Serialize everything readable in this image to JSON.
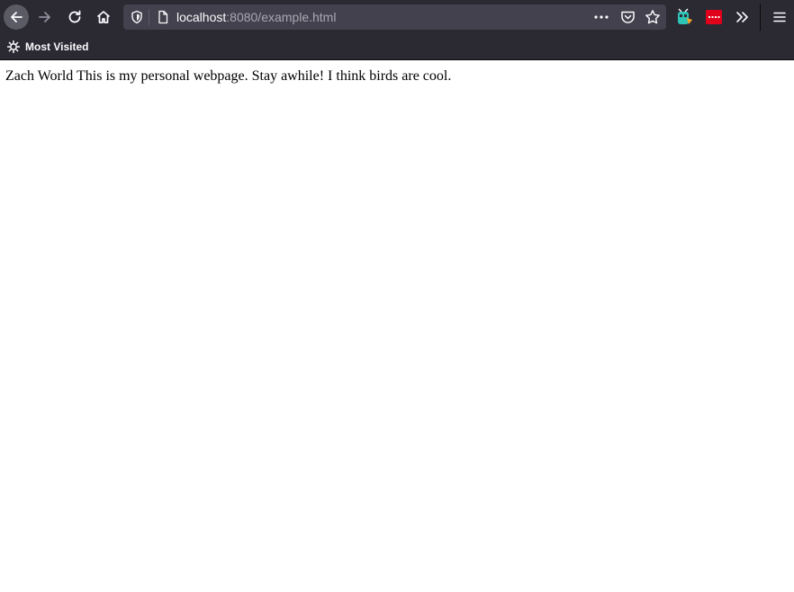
{
  "browser": {
    "url_host": "localhost",
    "url_rest": ":8080/example.html",
    "bookmarks": [
      {
        "label": "Most Visited",
        "icon": "gear-icon"
      }
    ],
    "icons": {
      "back": "arrow-left-icon",
      "forward": "arrow-right-icon",
      "reload": "reload-icon",
      "home": "home-icon",
      "tracking": "shield-icon",
      "page": "page-icon",
      "more": "ellipsis-icon",
      "pocket": "pocket-icon",
      "bookmark": "star-icon",
      "overflow": "chevron-double-right-icon",
      "menu": "hamburger-icon"
    },
    "colors": {
      "chrome": "#2b2a33",
      "urlbar": "#42414d",
      "ext_red": "#e0001b"
    }
  },
  "page": {
    "body_text": "Zach World This is my personal webpage. Stay awhile! I think birds are cool."
  }
}
